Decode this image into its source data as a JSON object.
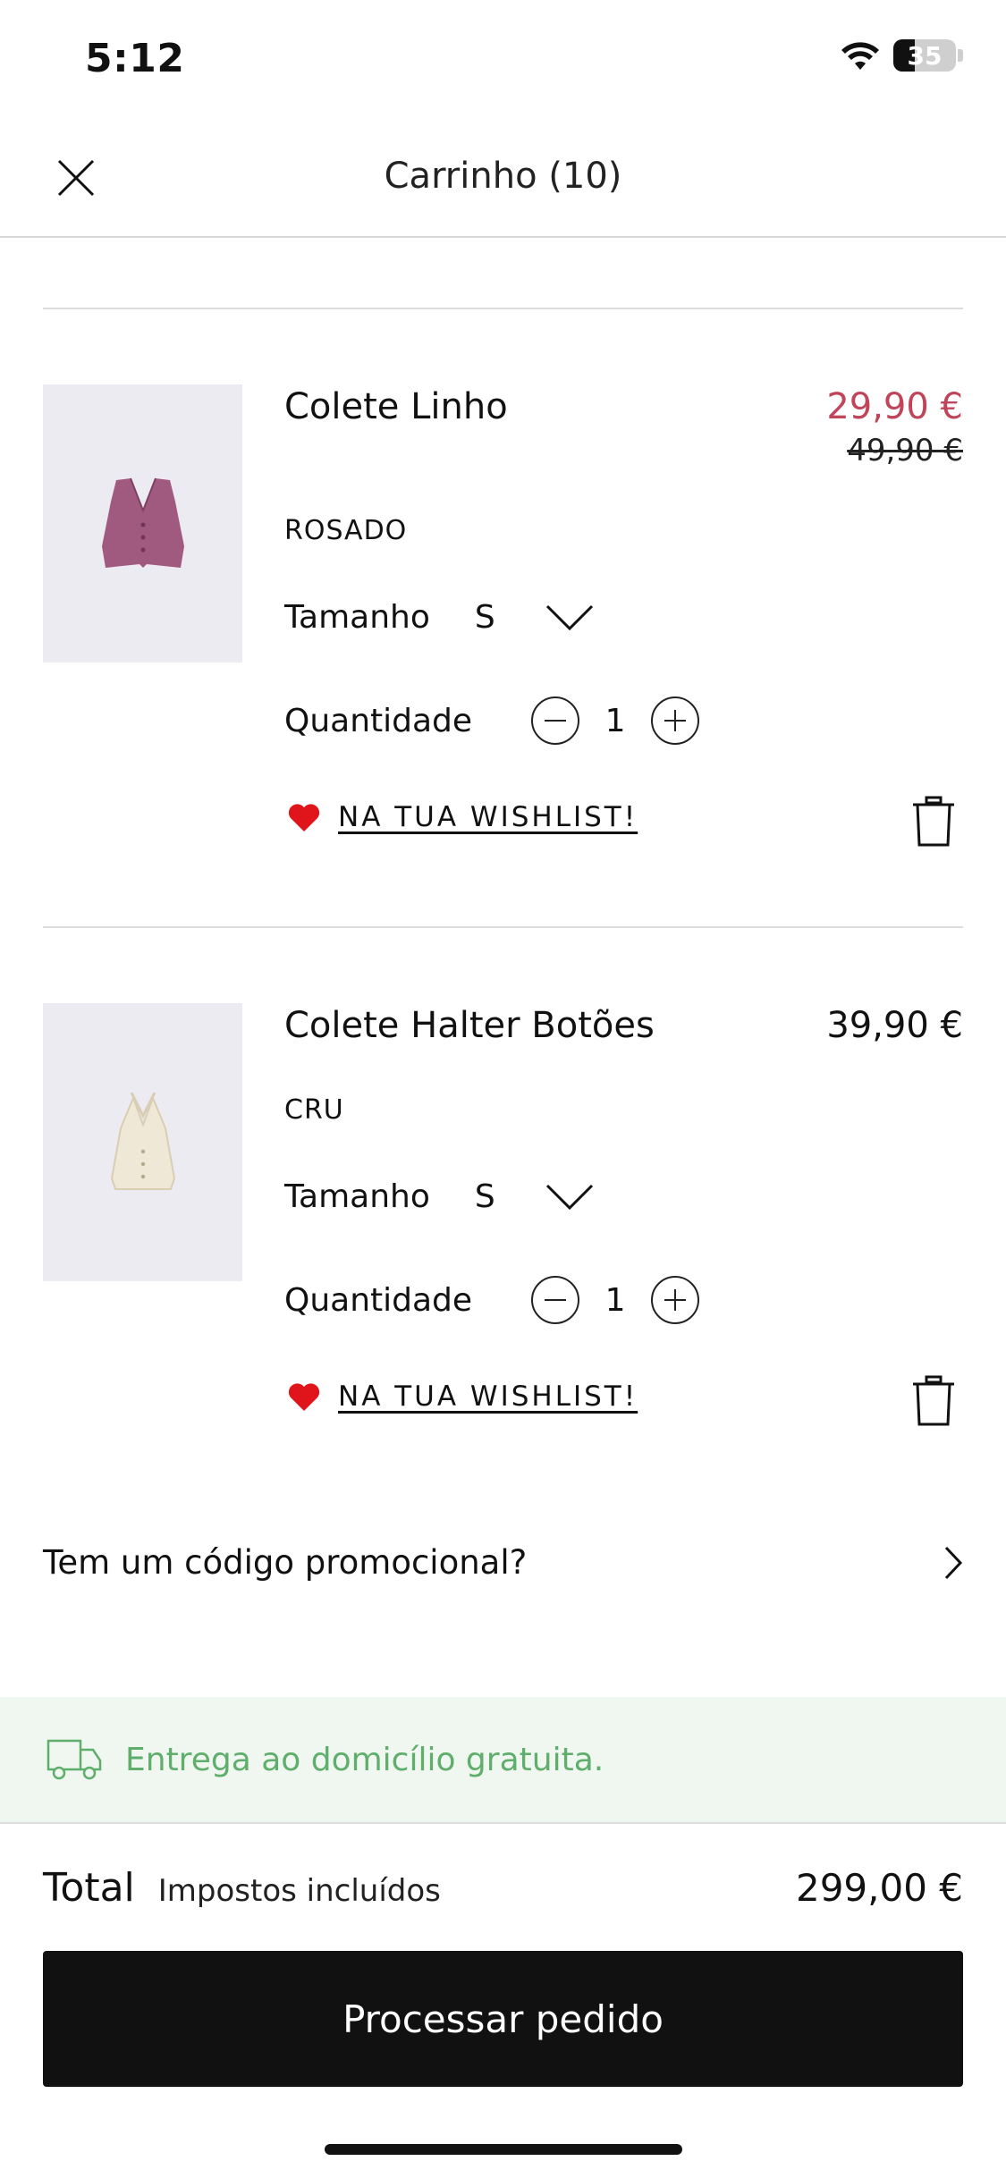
{
  "status": {
    "time": "5:12",
    "battery": "35"
  },
  "header": {
    "title": "Carrinho (10)"
  },
  "items": [
    {
      "name": "Colete Linho",
      "price": "29,90 €",
      "old_price": "49,90 €",
      "color": "ROSADO",
      "size_label": "Tamanho",
      "size": "S",
      "qty_label": "Quantidade",
      "qty": "1",
      "wishlist": "NA TUA WISHLIST!",
      "image_icon": "vest-pink"
    },
    {
      "name": "Colete Halter Botões",
      "price": "39,90 €",
      "color": "CRU",
      "size_label": "Tamanho",
      "size": "S",
      "qty_label": "Quantidade",
      "qty": "1",
      "wishlist": "NA TUA WISHLIST!",
      "image_icon": "halter-top-cream"
    }
  ],
  "promo": {
    "label": "Tem um código promocional?"
  },
  "delivery": {
    "label": "Entrega ao domicílio gratuita."
  },
  "total": {
    "label": "Total",
    "tax_note": "Impostos incluídos",
    "value": "299,00 €"
  },
  "checkout": {
    "label": "Processar pedido"
  },
  "colors": {
    "sale": "#c0455a",
    "delivery": "#5fae6b",
    "heart": "#e0141b"
  }
}
